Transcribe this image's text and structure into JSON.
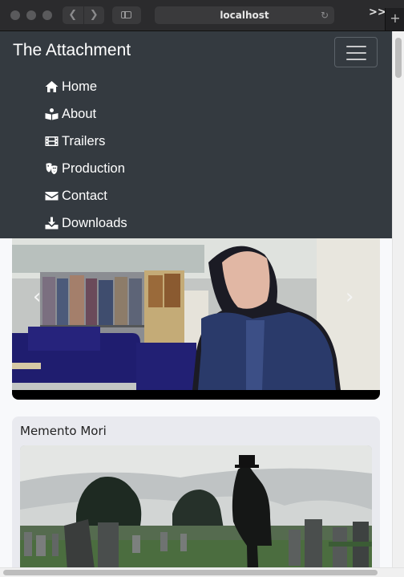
{
  "browser": {
    "url": "localhost",
    "back_icon": "chevron-left-icon",
    "forward_icon": "chevron-right-icon",
    "more_label": ">>",
    "new_tab_label": "+"
  },
  "navbar": {
    "brand": "The Attachment",
    "items": [
      {
        "label": "Home",
        "icon": "home-icon"
      },
      {
        "label": "About",
        "icon": "book-icon"
      },
      {
        "label": "Trailers",
        "icon": "film-icon"
      },
      {
        "label": "Production",
        "icon": "theater-masks-icon"
      },
      {
        "label": "Contact",
        "icon": "envelope-icon"
      },
      {
        "label": "Downloads",
        "icon": "download-icon"
      }
    ]
  },
  "carousel": {
    "prev_label": "‹",
    "next_label": "›"
  },
  "card": {
    "title": "Memento Mori"
  },
  "colors": {
    "navbar_bg": "#343a40",
    "page_bg": "#f8f9fb",
    "card_bg": "#e9eaef"
  }
}
